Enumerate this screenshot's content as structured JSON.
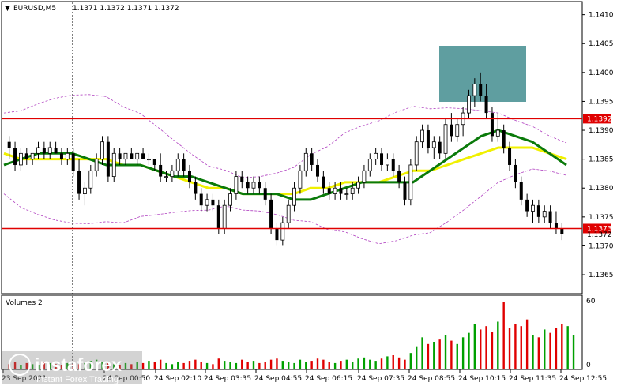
{
  "header": {
    "symbol": "EURUSD,M5",
    "ohlc": "1.1371 1.1372 1.1371 1.1372"
  },
  "price_axis": {
    "ticks": [
      "1.1410",
      "1.1405",
      "1.1400",
      "1.1395",
      "1.1390",
      "1.1385",
      "1.1380",
      "1.1375",
      "1.1370",
      "1.1365"
    ],
    "level_upper_tag": "1.1392",
    "level_lower_tag": "1.1373",
    "current_price_tag": "1.1372"
  },
  "volume_panel": {
    "title": "Volumes 2",
    "ticks": [
      "60",
      "0"
    ]
  },
  "time_axis": {
    "labels": [
      "23 Sep 2021",
      "24 Sep 00:50",
      "24 Sep 02:10",
      "24 Sep 03:35",
      "24 Sep 04:55",
      "24 Sep 06:15",
      "24 Sep 07:35",
      "24 Sep 08:55",
      "24 Sep 10:15",
      "24 Sep 11:35",
      "24 Sep 12:55"
    ]
  },
  "watermark": {
    "brand": "instaforex",
    "tagline": "Instant Forex Trading"
  },
  "colors": {
    "bull_candle": "#000000",
    "level_line": "#e00000",
    "ma_fast": "#0a7a0a",
    "ma_slow": "#f0f000",
    "bollinger": "#b040c0",
    "volume_up": "#00a000",
    "volume_down": "#e00000",
    "highlight_box": "#5f9ea0"
  },
  "chart_data": {
    "type": "candlestick",
    "price_range": [
      1.1362,
      1.1412
    ],
    "horizontal_levels": [
      1.1392,
      1.1373
    ],
    "candles": [
      [
        1.1388,
        1.1389,
        1.1385,
        1.1387
      ],
      [
        1.1387,
        1.1388,
        1.1383,
        1.1384
      ],
      [
        1.1384,
        1.1387,
        1.1383,
        1.1386
      ],
      [
        1.1386,
        1.1387,
        1.1384,
        1.1385
      ],
      [
        1.1385,
        1.1386,
        1.1384,
        1.1386
      ],
      [
        1.1386,
        1.1388,
        1.1385,
        1.1387
      ],
      [
        1.1387,
        1.1388,
        1.1385,
        1.1386
      ],
      [
        1.1386,
        1.1388,
        1.1385,
        1.1387
      ],
      [
        1.1387,
        1.1388,
        1.1386,
        1.1386
      ],
      [
        1.1386,
        1.1387,
        1.1384,
        1.1385
      ],
      [
        1.1385,
        1.1387,
        1.1384,
        1.1386
      ],
      [
        1.1386,
        1.1387,
        1.1382,
        1.1383
      ],
      [
        1.1383,
        1.1385,
        1.1378,
        1.1379
      ],
      [
        1.1379,
        1.1381,
        1.1377,
        1.138
      ],
      [
        1.138,
        1.1384,
        1.1379,
        1.1383
      ],
      [
        1.1383,
        1.1386,
        1.1382,
        1.1385
      ],
      [
        1.1385,
        1.1389,
        1.1384,
        1.1388
      ],
      [
        1.1388,
        1.1389,
        1.1381,
        1.1382
      ],
      [
        1.1382,
        1.1387,
        1.1381,
        1.1386
      ],
      [
        1.1386,
        1.1387,
        1.1384,
        1.1385
      ],
      [
        1.1385,
        1.1386,
        1.1384,
        1.1386
      ],
      [
        1.1386,
        1.1387,
        1.1385,
        1.1385
      ],
      [
        1.1385,
        1.1386,
        1.1384,
        1.1386
      ],
      [
        1.1386,
        1.1387,
        1.1385,
        1.1385
      ],
      [
        1.1385,
        1.1386,
        1.1384,
        1.1385
      ],
      [
        1.1385,
        1.1385,
        1.1383,
        1.1384
      ],
      [
        1.1384,
        1.1386,
        1.1381,
        1.1382
      ],
      [
        1.1382,
        1.1383,
        1.1381,
        1.1382
      ],
      [
        1.1382,
        1.1384,
        1.1381,
        1.1383
      ],
      [
        1.1383,
        1.1386,
        1.1382,
        1.1385
      ],
      [
        1.1385,
        1.1386,
        1.1382,
        1.1383
      ],
      [
        1.1383,
        1.1384,
        1.138,
        1.1381
      ],
      [
        1.1381,
        1.1382,
        1.1378,
        1.1379
      ],
      [
        1.1379,
        1.138,
        1.1376,
        1.1377
      ],
      [
        1.1377,
        1.1379,
        1.1376,
        1.1378
      ],
      [
        1.1378,
        1.1379,
        1.1376,
        1.1377
      ],
      [
        1.1377,
        1.1378,
        1.1372,
        1.1373
      ],
      [
        1.1373,
        1.1378,
        1.1372,
        1.1377
      ],
      [
        1.1377,
        1.138,
        1.1376,
        1.1379
      ],
      [
        1.1379,
        1.1383,
        1.1378,
        1.1382
      ],
      [
        1.1382,
        1.1383,
        1.138,
        1.1381
      ],
      [
        1.1381,
        1.1382,
        1.1379,
        1.138
      ],
      [
        1.138,
        1.1382,
        1.1379,
        1.1381
      ],
      [
        1.1381,
        1.1382,
        1.1379,
        1.138
      ],
      [
        1.138,
        1.1381,
        1.1377,
        1.1378
      ],
      [
        1.1378,
        1.1379,
        1.1372,
        1.1373
      ],
      [
        1.1373,
        1.1374,
        1.137,
        1.1371
      ],
      [
        1.1371,
        1.1375,
        1.137,
        1.1374
      ],
      [
        1.1374,
        1.1378,
        1.1373,
        1.1377
      ],
      [
        1.1377,
        1.1381,
        1.1376,
        1.138
      ],
      [
        1.138,
        1.1384,
        1.1379,
        1.1383
      ],
      [
        1.1383,
        1.1387,
        1.1382,
        1.1386
      ],
      [
        1.1386,
        1.1387,
        1.1383,
        1.1384
      ],
      [
        1.1384,
        1.1385,
        1.1381,
        1.1382
      ],
      [
        1.1382,
        1.1383,
        1.1379,
        1.138
      ],
      [
        1.138,
        1.1381,
        1.1378,
        1.1379
      ],
      [
        1.1379,
        1.1381,
        1.1378,
        1.138
      ],
      [
        1.138,
        1.1381,
        1.1378,
        1.1379
      ],
      [
        1.1379,
        1.138,
        1.1378,
        1.1379
      ],
      [
        1.1379,
        1.1381,
        1.1378,
        1.138
      ],
      [
        1.138,
        1.1382,
        1.1379,
        1.1381
      ],
      [
        1.1381,
        1.1384,
        1.138,
        1.1383
      ],
      [
        1.1383,
        1.1386,
        1.1382,
        1.1385
      ],
      [
        1.1385,
        1.1387,
        1.1384,
        1.1386
      ],
      [
        1.1386,
        1.1387,
        1.1383,
        1.1384
      ],
      [
        1.1384,
        1.1386,
        1.1383,
        1.1385
      ],
      [
        1.1385,
        1.1386,
        1.1382,
        1.1383
      ],
      [
        1.1383,
        1.1384,
        1.138,
        1.1381
      ],
      [
        1.1381,
        1.1382,
        1.1377,
        1.1378
      ],
      [
        1.1378,
        1.1385,
        1.1377,
        1.1384
      ],
      [
        1.1384,
        1.1389,
        1.1383,
        1.1388
      ],
      [
        1.1388,
        1.1391,
        1.1387,
        1.139
      ],
      [
        1.139,
        1.1391,
        1.1386,
        1.1387
      ],
      [
        1.1387,
        1.1389,
        1.1385,
        1.1388
      ],
      [
        1.1388,
        1.1389,
        1.1385,
        1.1386
      ],
      [
        1.1386,
        1.1392,
        1.1385,
        1.1391
      ],
      [
        1.1391,
        1.1393,
        1.1388,
        1.1389
      ],
      [
        1.1389,
        1.1392,
        1.1388,
        1.1391
      ],
      [
        1.1391,
        1.1394,
        1.1389,
        1.1393
      ],
      [
        1.1393,
        1.1397,
        1.1392,
        1.1396
      ],
      [
        1.1396,
        1.1399,
        1.1394,
        1.1398
      ],
      [
        1.1398,
        1.14,
        1.1395,
        1.1396
      ],
      [
        1.1396,
        1.1398,
        1.1392,
        1.1393
      ],
      [
        1.1393,
        1.1394,
        1.1388,
        1.1389
      ],
      [
        1.1389,
        1.1393,
        1.1388,
        1.139
      ],
      [
        1.139,
        1.1391,
        1.1386,
        1.1387
      ],
      [
        1.1387,
        1.1388,
        1.1383,
        1.1384
      ],
      [
        1.1384,
        1.1385,
        1.138,
        1.1381
      ],
      [
        1.1381,
        1.1382,
        1.1377,
        1.1378
      ],
      [
        1.1378,
        1.1379,
        1.1375,
        1.1376
      ],
      [
        1.1376,
        1.1378,
        1.1374,
        1.1377
      ],
      [
        1.1377,
        1.1378,
        1.1374,
        1.1375
      ],
      [
        1.1375,
        1.1377,
        1.1374,
        1.1376
      ],
      [
        1.1376,
        1.1377,
        1.1373,
        1.1374
      ],
      [
        1.1374,
        1.1376,
        1.1372,
        1.1373
      ],
      [
        1.1373,
        1.1374,
        1.1371,
        1.1372
      ]
    ],
    "ma_fast": [
      1.1384,
      1.1385,
      1.1386,
      1.1386,
      1.1386,
      1.1385,
      1.1384,
      1.1384,
      1.1384,
      1.1383,
      1.1382,
      1.1382,
      1.1381,
      1.138,
      1.1379,
      1.1379,
      1.1379,
      1.1378,
      1.1378,
      1.1379,
      1.138,
      1.1381,
      1.1381,
      1.1381,
      1.1381,
      1.1383,
      1.1385,
      1.1387,
      1.1389,
      1.139,
      1.1389,
      1.1388,
      1.1386,
      1.1384
    ],
    "ma_slow": [
      1.1386,
      1.1385,
      1.1385,
      1.1385,
      1.1385,
      1.1385,
      1.1385,
      1.1384,
      1.1384,
      1.1383,
      1.1382,
      1.1381,
      1.138,
      1.138,
      1.1379,
      1.1379,
      1.1379,
      1.1379,
      1.138,
      1.138,
      1.1381,
      1.1381,
      1.1381,
      1.1382,
      1.1383,
      1.1383,
      1.1384,
      1.1385,
      1.1386,
      1.1387,
      1.1387,
      1.1387,
      1.1386,
      1.1385
    ],
    "volumes": [
      4,
      6,
      3,
      5,
      4,
      3,
      6,
      5,
      4,
      3,
      5,
      6,
      4,
      5,
      7,
      8,
      6,
      5,
      4,
      3,
      5,
      4,
      6,
      5,
      7,
      6,
      8,
      5,
      4,
      6,
      5,
      7,
      8,
      6,
      5,
      4,
      9,
      7,
      6,
      5,
      8,
      6,
      7,
      5,
      6,
      8,
      9,
      7,
      6,
      5,
      8,
      6,
      7,
      9,
      8,
      6,
      5,
      7,
      8,
      6,
      9,
      10,
      8,
      7,
      9,
      11,
      12,
      10,
      8,
      14,
      20,
      28,
      22,
      24,
      26,
      30,
      25,
      22,
      28,
      32,
      40,
      35,
      38,
      33,
      42,
      60,
      36,
      40,
      38,
      44,
      30,
      28,
      35,
      32,
      36,
      40,
      38,
      30
    ]
  }
}
